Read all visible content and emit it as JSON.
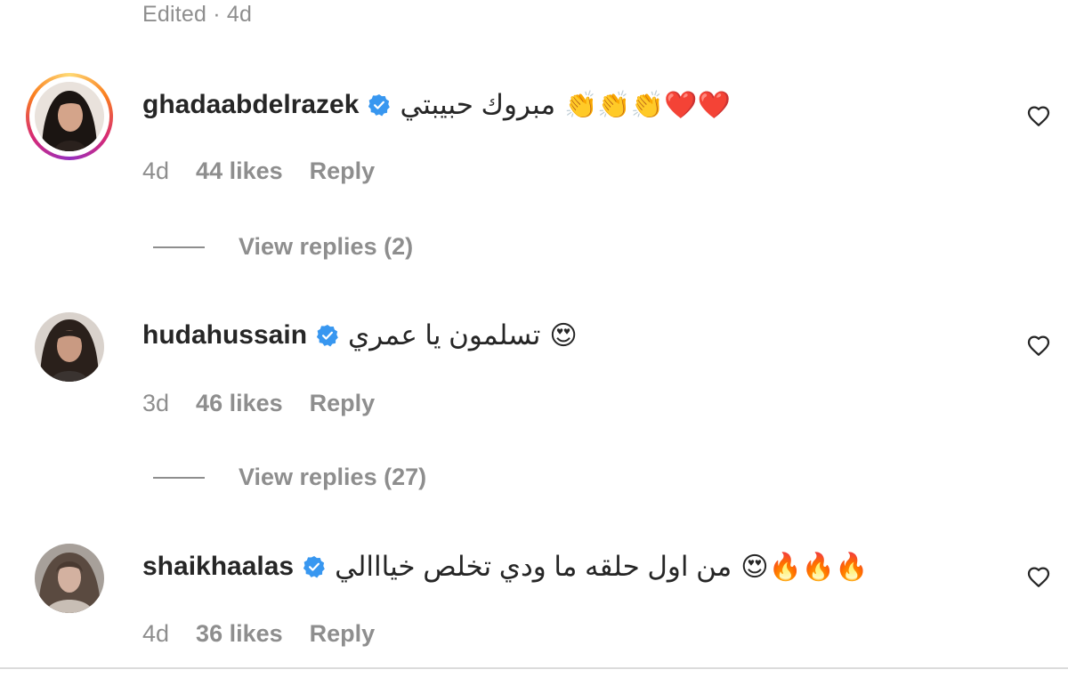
{
  "top_meta": "Edited · 4d",
  "comments": [
    {
      "username": "ghadaabdelrazek",
      "text": "مبروك حبيبتي",
      "emojis": "👏👏👏❤️❤️",
      "time": "4d",
      "likes": "44 likes",
      "reply": "Reply",
      "view_replies": "View replies (2)",
      "has_story_ring": true
    },
    {
      "username": "hudahussain",
      "text": "تسلمون يا عمري",
      "emojis": "😍",
      "time": "3d",
      "likes": "46 likes",
      "reply": "Reply",
      "view_replies": "View replies (27)",
      "has_story_ring": false
    },
    {
      "username": "shaikhaalas",
      "text": "من اول حلقه ما ودي تخلص خيااالي",
      "emojis": "😍🔥🔥🔥",
      "time": "4d",
      "likes": "36 likes",
      "reply": "Reply",
      "has_story_ring": false
    }
  ],
  "icons": {
    "verified": "verified-badge-icon",
    "like": "heart-outline-icon"
  },
  "colors": {
    "verified_blue": "#3897f0",
    "muted_text": "#8e8e8e",
    "primary_text": "#262626"
  }
}
